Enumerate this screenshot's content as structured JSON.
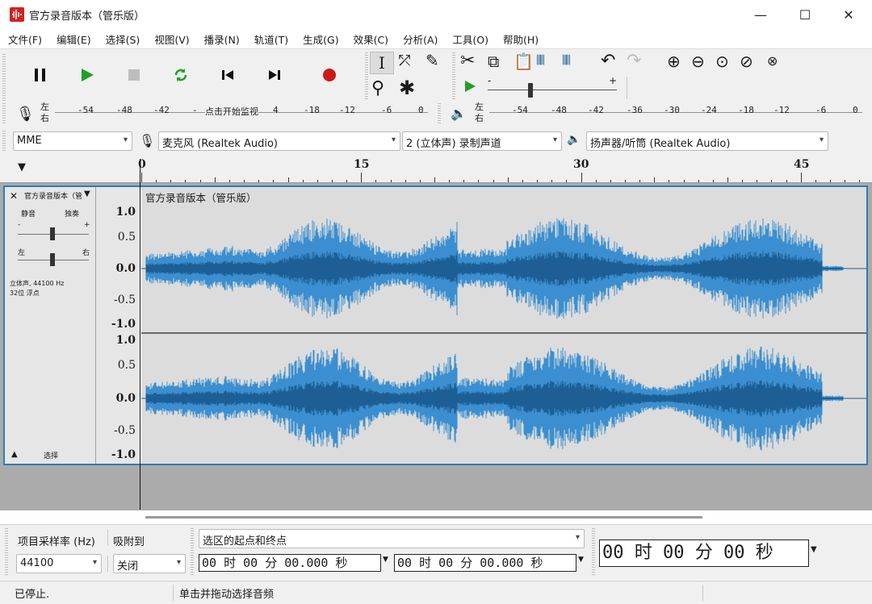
{
  "window": {
    "title": "官方录音版本（管乐版）",
    "minimize": "—",
    "maximize": "☐",
    "close": "✕"
  },
  "menu": [
    "文件(F)",
    "编辑(E)",
    "选择(S)",
    "视图(V)",
    "播录(N)",
    "轨道(T)",
    "生成(G)",
    "效果(C)",
    "分析(A)",
    "工具(O)",
    "帮助(H)"
  ],
  "transport": {
    "pause_icon": "pause-icon",
    "play_icon": "play-icon",
    "stop_icon": "stop-icon",
    "loop_icon": "loop-icon",
    "skip_start_icon": "skip-to-start-icon",
    "skip_end_icon": "skip-to-end-icon",
    "record_icon": "record-icon",
    "colors": {
      "play": "#22a022",
      "loop": "#22a022",
      "record": "#cc1a1a",
      "stop": "#bdbdbd"
    }
  },
  "meters": {
    "record": {
      "left": "左",
      "right": "右",
      "ticks": [
        "-54",
        "-48",
        "-42",
        "-",
        "-",
        "4",
        "-18",
        "-12",
        "-6",
        "0"
      ],
      "monitor_hint": "点击开始监视"
    },
    "play": {
      "left": "左",
      "right": "右",
      "ticks": [
        "-54",
        "-48",
        "-42",
        "-36",
        "-30",
        "-24",
        "-18",
        "-12",
        "-6",
        "0"
      ]
    }
  },
  "playback_speed": {
    "minus": "-",
    "plus": "+"
  },
  "devices": {
    "host": "MME",
    "mic": "麦克风 (Realtek Audio)",
    "channels": "2 (立体声) 录制声道",
    "speaker": "扬声器/听筒 (Realtek Audio)"
  },
  "ruler": {
    "labels": [
      "0",
      "15",
      "30",
      "45"
    ]
  },
  "track": {
    "name": "官方录音版本（管",
    "clip_title": "官方录音版本（管乐版）",
    "mute": "静音",
    "solo": "独奏",
    "gain_minus": "-",
    "gain_plus": "+",
    "pan_left": "左",
    "pan_right": "右",
    "info_line1": "立体声, 44100 Hz",
    "info_line2": "32位 浮点",
    "select": "选择",
    "vruler_top": [
      "1.0",
      "0.5",
      "0.0",
      "-0.5",
      "-1.0"
    ],
    "vruler_bottom": [
      "1.0",
      "0.5",
      "0.0",
      "-0.5",
      "-1.0"
    ],
    "wave_color": "#3b8fd0",
    "wave_dark": "#1d5f95"
  },
  "bottom": {
    "rate_label": "项目采样率 (Hz)",
    "snap_label": "吸附到",
    "rate_value": "44100",
    "snap_value": "关闭",
    "selection_mode": "选区的起点和终点",
    "sel_start": "00 时 00 分 00.000 秒",
    "sel_end": "00 时 00 分 00.000 秒",
    "position": "00 时 00 分 00 秒"
  },
  "status": {
    "state": "已停止.",
    "hint": "单击并拖动选择音频"
  }
}
